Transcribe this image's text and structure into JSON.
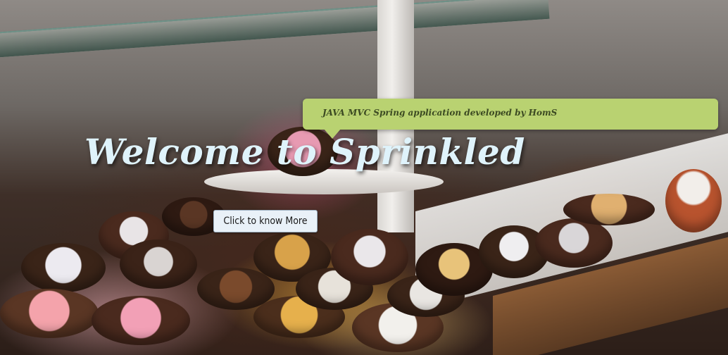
{
  "hero": {
    "title": "Welcome to Sprinkled",
    "cta_label": "Click to know More",
    "background_image": "donut-display-photo"
  },
  "tooltip": {
    "text": "JAVA MVC Spring application developed by HomS"
  },
  "colors": {
    "title": "#dff3fb",
    "tooltip_bg": "#b9d271",
    "tooltip_text": "#3c4a22",
    "button_bg": "#e9f1f8"
  }
}
